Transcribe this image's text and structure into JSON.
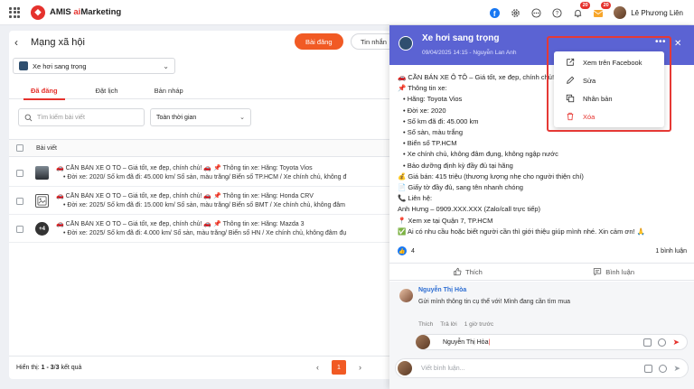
{
  "topbar": {
    "brand": "AMIS ",
    "brand_ai": "ai",
    "brand_rest": "Marketing",
    "badge_bell": "20",
    "badge_inbox": "20",
    "user_name": "Lê Phương Liên"
  },
  "main": {
    "title": "Mạng xã hội",
    "post_button": "Bài đăng",
    "message_button": "Tin nhắn",
    "page_select": "Xe hơi sang trọng",
    "tabs": [
      "Đã đăng",
      "Đặt lịch",
      "Bản nháp"
    ],
    "search_placeholder": "Tìm kiếm bài viết",
    "time_filter": "Toàn thời gian",
    "column_header": "Bài viết",
    "rows": [
      {
        "thumb": "",
        "line1": "🚗 CẦN BÁN XE Ô TÔ – Giá tốt, xe đẹp, chính chủ! 🚗 📌 Thông tin xe: Hãng: Toyota Vios",
        "line2": "• Đời xe: 2020/ Số km đã đi: 45.000 km/ Số sàn, màu trắng/ Biển số TP.HCM / Xe chính chủ, không đ"
      },
      {
        "thumb": "",
        "line1": "🚗 CẦN BÁN XE Ô TÔ – Giá tốt, xe đẹp, chính chủ! 🚗 📌 Thông tin xe: Hãng: Honda CRV",
        "line2": "• Đời xe: 2025/ Số km đã đi: 15.000 km/ Số sàn, màu trắng/ Biển số BMT / Xe chính chủ, không đâm"
      },
      {
        "thumb": "+4",
        "line1": "🚗 CẦN BÁN XE Ô TÔ – Giá tốt, xe đẹp, chính chủ! 🚗 📌 Thông tin xe: Hãng: Mazda 3",
        "line2": "• Đời xe: 2025/ Số km đã đi: 4.000 km/ Số sàn, màu trắng/ Biển số HN / Xe chính chủ, không đâm đụ"
      }
    ],
    "footer_prefix": "Hiển thị: ",
    "footer_range": "1 - 3",
    "footer_sep": "/",
    "footer_total": "3",
    "footer_suffix": " kết quả",
    "current_page": "1"
  },
  "detail": {
    "page_name": "Xe hơi sang trọng",
    "meta": "09/04/2025 14:15 - Nguyễn Lan Anh",
    "content_lines": [
      "🚗 CẦN BÁN XE Ô TÔ – Giá tốt, xe đẹp, chính chủ! 🚗",
      "📌 Thông tin xe:",
      "• Hãng: Toyota Vios",
      "• Đời xe: 2020",
      "• Số km đã đi: 45.000 km",
      "• Số sàn, màu trắng",
      "• Biển số TP.HCM",
      "• Xe chính chủ, không đâm đụng, không ngập nước",
      "• Bảo dưỡng định kỳ đầy đủ tại hãng",
      "💰 Giá bán: 415 triệu (thương lượng nhẹ cho người thiện chí)",
      "📄 Giấy tờ đầy đủ, sang tên nhanh chóng",
      "📞 Liên hệ:",
      "Anh Hưng – 0909.XXX.XXX (Zalo/call trực tiếp)",
      "📍 Xem xe tại Quận 7, TP.HCM",
      "✅ Ai có nhu cầu hoặc biết người cần thì giới thiệu giúp mình nhé. Xin cảm ơn! 🙏"
    ],
    "like_count": "4",
    "comment_count": "1 bình luận",
    "like_label": "Thích",
    "comment_label": "Bình luận",
    "comment": {
      "author": "Nguyễn Thị Hòa",
      "text": "Gửi mình thông tin cụ thể với! Mình đang cần tìm mua",
      "like": "Thích",
      "reply": "Trả lời",
      "time": "1 giờ trước"
    },
    "reply_value": "Nguyễn Thị Hòa",
    "comment_placeholder": "Viết bình luận..."
  },
  "menu": {
    "items": [
      {
        "label": "Xem trên Facebook",
        "icon": "external-link-icon"
      },
      {
        "label": "Sửa",
        "icon": "pencil-icon"
      },
      {
        "label": "Nhân bản",
        "icon": "copy-icon"
      },
      {
        "label": "Xóa",
        "icon": "trash-icon"
      }
    ],
    "highlight_color": "#e53935"
  },
  "colors": {
    "accent": "#f15a24",
    "header": "#5b63d3",
    "danger": "#e5322d"
  }
}
